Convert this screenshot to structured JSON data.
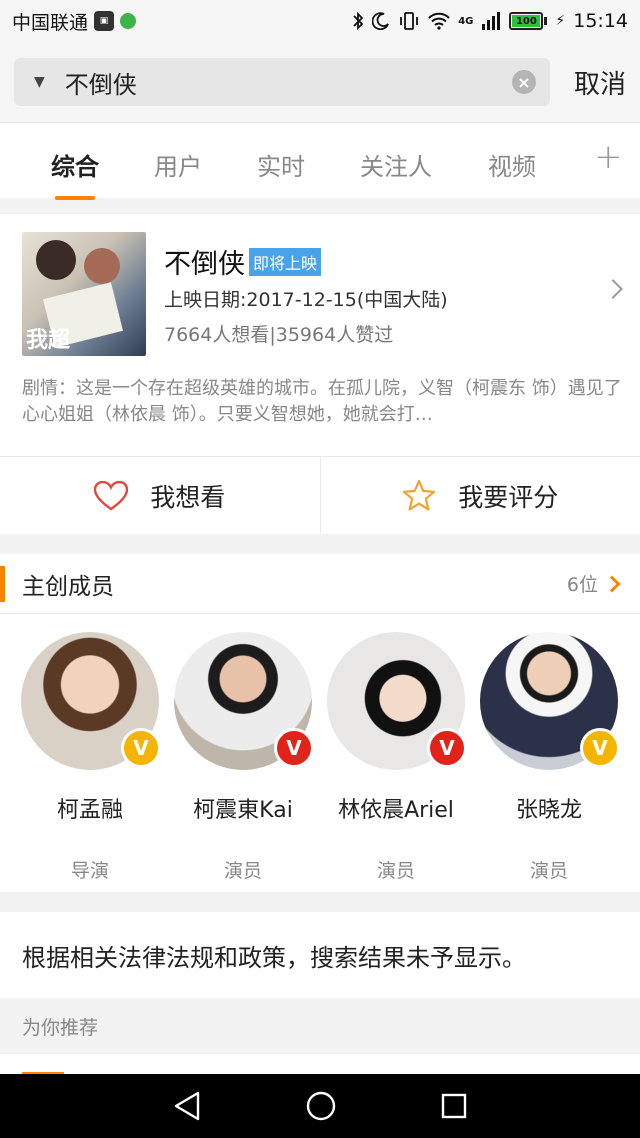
{
  "status_bar": {
    "carrier": "中国联通",
    "network": "4G",
    "battery": "100",
    "time": "15:14"
  },
  "search": {
    "query": "不倒侠",
    "cancel_label": "取消"
  },
  "tabs": [
    {
      "label": "综合",
      "active": true
    },
    {
      "label": "用户",
      "active": false
    },
    {
      "label": "实时",
      "active": false
    },
    {
      "label": "关注人",
      "active": false
    },
    {
      "label": "视频",
      "active": false
    }
  ],
  "movie": {
    "title": "不倒侠",
    "badge": "即将上映",
    "release": "上映日期:2017-12-15(中国大陆)",
    "stats": "7664人想看|35964人赞过",
    "plot": "剧情：这是一个存在超级英雄的城市。在孤儿院，义智（柯震东 饰）遇见了心心姐姐（林依晨 饰）。只要义智想她，她就会打…",
    "poster_text": "我超"
  },
  "actions": {
    "want_label": "我想看",
    "rate_label": "我要评分"
  },
  "cast": {
    "title": "主创成员",
    "count": "6位",
    "members": [
      {
        "name": "柯孟融",
        "role": "导演",
        "badge_color": "#f5b400"
      },
      {
        "name": "柯震東Kai",
        "role": "演员",
        "badge_color": "#e2231a"
      },
      {
        "name": "林依晨Ariel",
        "role": "演员",
        "badge_color": "#e2231a"
      },
      {
        "name": "张晓龙",
        "role": "演员",
        "badge_color": "#f5b400"
      }
    ]
  },
  "notice": "根据相关法律法规和政策，搜索结果未予显示。",
  "recommend_label": "为你推荐",
  "colors": {
    "accent": "#ff8200",
    "badge_blue": "#4aa3ea"
  }
}
